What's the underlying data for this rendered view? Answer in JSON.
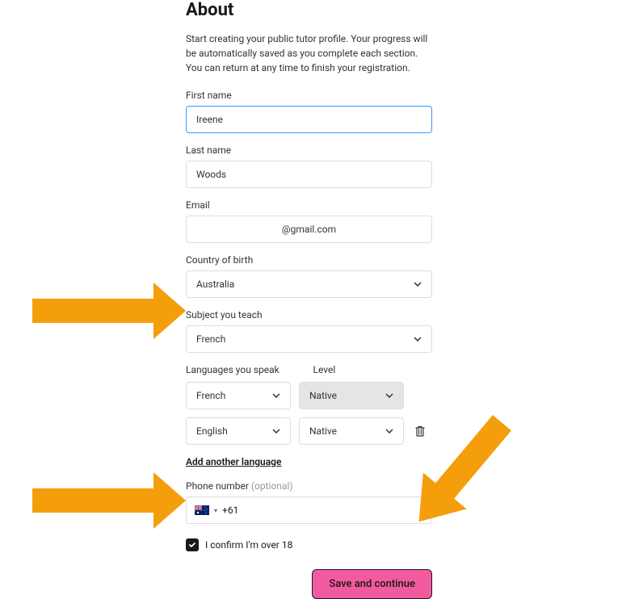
{
  "title": "About",
  "subtitle": "Start creating your public tutor profile. Your progress will be automatically saved as you complete each section. You can return at any time to finish your registration.",
  "fields": {
    "first_name": {
      "label": "First name",
      "value": "Ireene"
    },
    "last_name": {
      "label": "Last name",
      "value": "Woods"
    },
    "email": {
      "label": "Email",
      "value": "@gmail.com"
    },
    "country": {
      "label": "Country of birth",
      "value": "Australia"
    },
    "subject": {
      "label": "Subject you teach",
      "value": "French"
    },
    "languages": {
      "label": "Languages you speak",
      "level_label": "Level",
      "rows": [
        {
          "language": "French",
          "level": "Native",
          "level_disabled": true,
          "deletable": false
        },
        {
          "language": "English",
          "level": "Native",
          "level_disabled": false,
          "deletable": true
        }
      ],
      "add_link": "Add another language"
    },
    "phone": {
      "label": "Phone number",
      "optional": "(optional)",
      "dialcode": "+61"
    },
    "confirm": {
      "label": "I confirm I'm over 18",
      "checked": true
    },
    "save_button": "Save and continue"
  }
}
